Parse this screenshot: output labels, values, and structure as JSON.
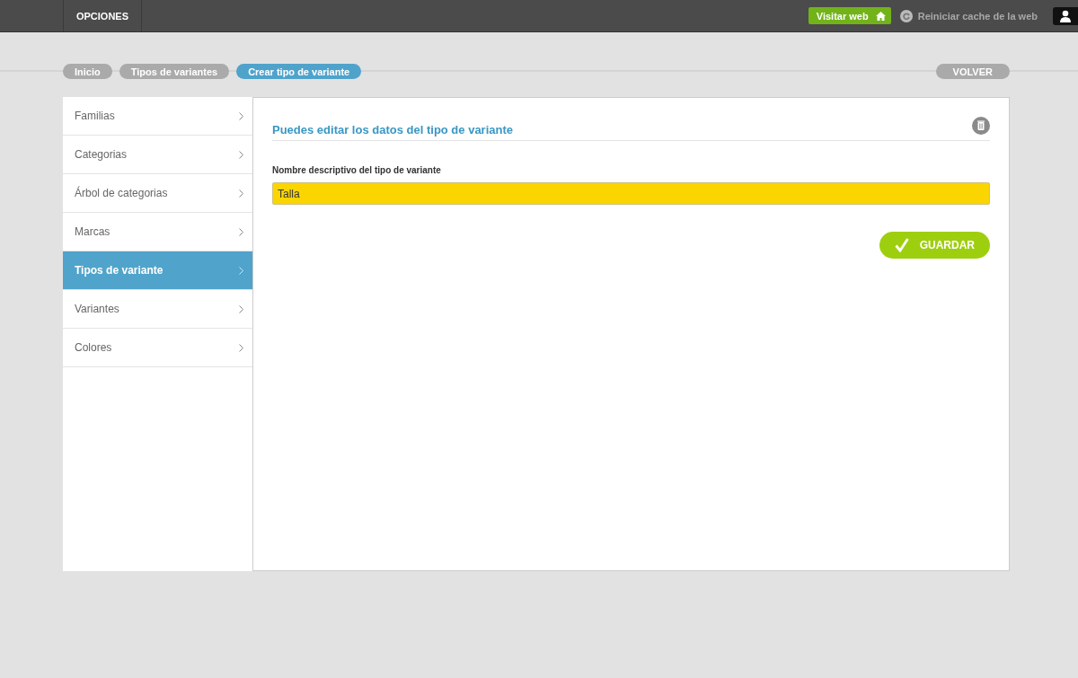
{
  "topbar": {
    "menu_label": "OPCIONES",
    "visit_button": "Visitar web",
    "reset_cache_link": "Reiniciar cache de la web"
  },
  "breadcrumbs": [
    {
      "label": "Inicio",
      "selected": false
    },
    {
      "label": "Tipos de variantes",
      "selected": false
    },
    {
      "label": "Crear tipo de variante",
      "selected": true
    }
  ],
  "back_button": "VOLVER",
  "sidebar": {
    "items": [
      {
        "label": "Familias",
        "selected": false
      },
      {
        "label": "Categorias",
        "selected": false
      },
      {
        "label": "Árbol de categorias",
        "selected": false
      },
      {
        "label": "Marcas",
        "selected": false
      },
      {
        "label": "Tipos de variante",
        "selected": true
      },
      {
        "label": "Variantes",
        "selected": false
      },
      {
        "label": "Colores",
        "selected": false
      }
    ]
  },
  "form": {
    "title": "Puedes editar los datos del tipo de variante",
    "field_label": "Nombre descriptivo del tipo de variante",
    "field_value": "Talla",
    "save_button": "GUARDAR"
  }
}
